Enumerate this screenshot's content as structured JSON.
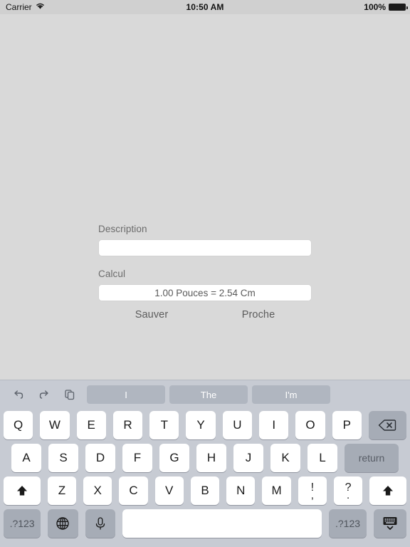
{
  "status_bar": {
    "carrier": "Carrier",
    "wifi_icon": "wifi-icon",
    "time": "10:50 AM",
    "battery_percent": "100%",
    "battery_icon": "battery-full-icon"
  },
  "form": {
    "description_label": "Description",
    "description_value": "",
    "description_placeholder": "",
    "calcul_label": "Calcul",
    "calcul_value": "1.00 Pouces = 2.54 Cm",
    "save_label": "Sauver",
    "close_label": "Proche"
  },
  "keyboard": {
    "edit_icons": [
      {
        "name": "undo-icon",
        "label": "undo"
      },
      {
        "name": "redo-icon",
        "label": "redo"
      },
      {
        "name": "paste-icon",
        "label": "paste"
      }
    ],
    "suggestions": [
      "I",
      "The",
      "I'm"
    ],
    "row1": [
      "Q",
      "W",
      "E",
      "R",
      "T",
      "Y",
      "U",
      "I",
      "O",
      "P"
    ],
    "row2": [
      "A",
      "S",
      "D",
      "F",
      "G",
      "H",
      "J",
      "K",
      "L"
    ],
    "row3": [
      "Z",
      "X",
      "C",
      "V",
      "B",
      "N",
      "M"
    ],
    "backspace_icon": "backspace-icon",
    "return_label": "return",
    "shift_left_icon": "shift-icon",
    "shift_right_icon": "shift-icon",
    "punct_exclaim": {
      "top": "!",
      "bottom": ","
    },
    "punct_question": {
      "top": "?",
      "bottom": "."
    },
    "numeric_left_label": ".?123",
    "numeric_right_label": ".?123",
    "globe_icon": "globe-icon",
    "mic_icon": "microphone-icon",
    "space_label": "",
    "dismiss_icon": "dismiss-keyboard-icon"
  },
  "colors": {
    "content_background": "#d9d9d9",
    "keyboard_background": "#c7cbd3",
    "key_light": "#ffffff",
    "key_dark": "#a6acb6",
    "suggestion_chip": "#b0b6c0",
    "label_text": "#6b6b6b"
  }
}
